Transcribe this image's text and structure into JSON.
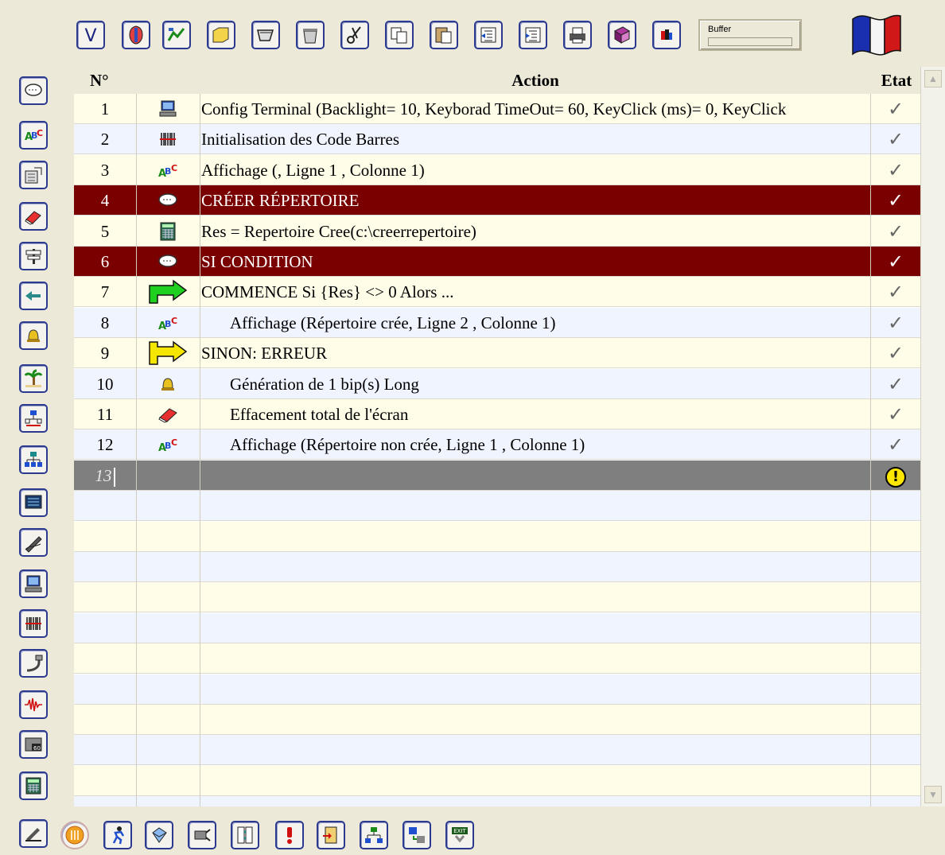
{
  "toolbar": {
    "top_icons": [
      "variable-icon",
      "shield-icon",
      "graph-icon",
      "folder-icon",
      "open-icon",
      "trash-icon",
      "scissors-icon",
      "copy-icon",
      "paste-icon",
      "outdent-icon",
      "indent-icon",
      "print-icon",
      "book-icon",
      "color-icon"
    ],
    "buffer_label": "Buffer",
    "flag": "french-flag-icon"
  },
  "left_toolbar": [
    "comment-icon",
    "display-text-icon",
    "terminal-config-icon",
    "eraser-icon",
    "signpost-icon",
    "arrow-left-icon",
    "bell-icon",
    "palm-tree-icon",
    "network-icon",
    "hierarchy-icon",
    "screen-icon",
    "pen-icon",
    "computer-icon",
    "barcode-icon",
    "cable-icon",
    "signal-icon",
    "timer-icon",
    "calculator-icon"
  ],
  "bottom_toolbar": [
    "sign-icon",
    "coin-icon",
    "run-icon",
    "cube-icon",
    "sensor-icon",
    "sequence-icon",
    "alert-icon",
    "door-icon",
    "tree-icon",
    "transfer-icon",
    "exit-icon"
  ],
  "table": {
    "headers": {
      "num": "N°",
      "action": "Action",
      "state": "Etat"
    },
    "rows": [
      {
        "num": "1",
        "icon": "computer-icon",
        "action": "Config Terminal (Backlight= 10, Keyborad TimeOut= 60, KeyClick (ms)= 0, KeyClick",
        "state": "✓"
      },
      {
        "num": "2",
        "icon": "barcode-icon",
        "action": "Initialisation des Code Barres",
        "state": "✓"
      },
      {
        "num": "3",
        "icon": "display-text-icon",
        "action": "Affichage (, Ligne 1 , Colonne 1)",
        "state": "✓"
      },
      {
        "num": "4",
        "icon": "comment-icon",
        "action": "CRÉER RÉPERTOIRE",
        "state": "✓"
      },
      {
        "num": "5",
        "icon": "calculator-icon",
        "action": "Res = Repertoire Cree(c:\\creerrepertoire)",
        "state": "✓"
      },
      {
        "num": "6",
        "icon": "comment-icon",
        "action": "SI CONDITION",
        "state": "✓"
      },
      {
        "num": "7",
        "icon": "green-arrow-icon",
        "action": "COMMENCE Si {Res} <> 0 Alors ...",
        "state": "✓"
      },
      {
        "num": "8",
        "icon": "display-text-icon",
        "action": "Affichage (Répertoire crée, Ligne 2 , Colonne 1)",
        "state": "✓"
      },
      {
        "num": "9",
        "icon": "yellow-arrow-icon",
        "action": "SINON: ERREUR",
        "state": "✓"
      },
      {
        "num": "10",
        "icon": "bell-icon",
        "action": "Génération de 1 bip(s) Long",
        "state": "✓"
      },
      {
        "num": "11",
        "icon": "eraser-icon",
        "action": "Effacement total de l'écran",
        "state": "✓"
      },
      {
        "num": "12",
        "icon": "display-text-icon",
        "action": "Affichage (Répertoire non crée, Ligne 1 , Colonne 1)",
        "state": "✓"
      },
      {
        "num": "13",
        "icon": "",
        "action": "",
        "state": "!"
      }
    ]
  }
}
